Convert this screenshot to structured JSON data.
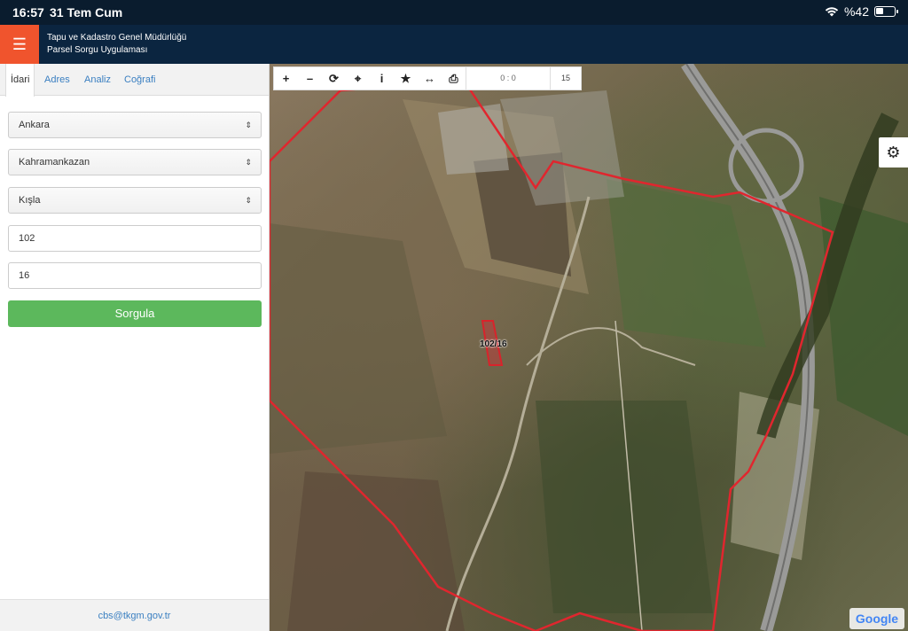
{
  "status_bar": {
    "time": "16:57",
    "date": "31 Tem Cum",
    "battery": "%42",
    "battery_level": 0.42
  },
  "header": {
    "title_line1": "Tapu ve Kadastro Genel Müdürlüğü",
    "title_line2": "Parsel Sorgu Uygulaması",
    "menu_icon": "hamburger-icon"
  },
  "sidebar": {
    "tabs": [
      {
        "label": "İdari",
        "active": true
      },
      {
        "label": "Adres",
        "active": false
      },
      {
        "label": "Analiz",
        "active": false
      },
      {
        "label": "Coğrafi",
        "active": false
      }
    ],
    "form": {
      "province": "Ankara",
      "district": "Kahramankazan",
      "neighborhood": "Kışla",
      "block": "102",
      "parcel": "16",
      "submit_label": "Sorgula"
    },
    "footer_email": "cbs@tkgm.gov.tr"
  },
  "map": {
    "toolbar": {
      "tools": [
        "zoom-in-icon",
        "zoom-out-icon",
        "refresh-icon",
        "locate-icon",
        "info-icon",
        "star-icon",
        "measure-icon",
        "print-icon"
      ],
      "coordinates": "0 : 0",
      "zoom_level": "15"
    },
    "parcel_label": "102/16",
    "attribution": "Google",
    "colors": {
      "boundary": "#e0262e",
      "accent": "#f0542d",
      "submit": "#5cb85c",
      "header": "#0b2540"
    }
  }
}
